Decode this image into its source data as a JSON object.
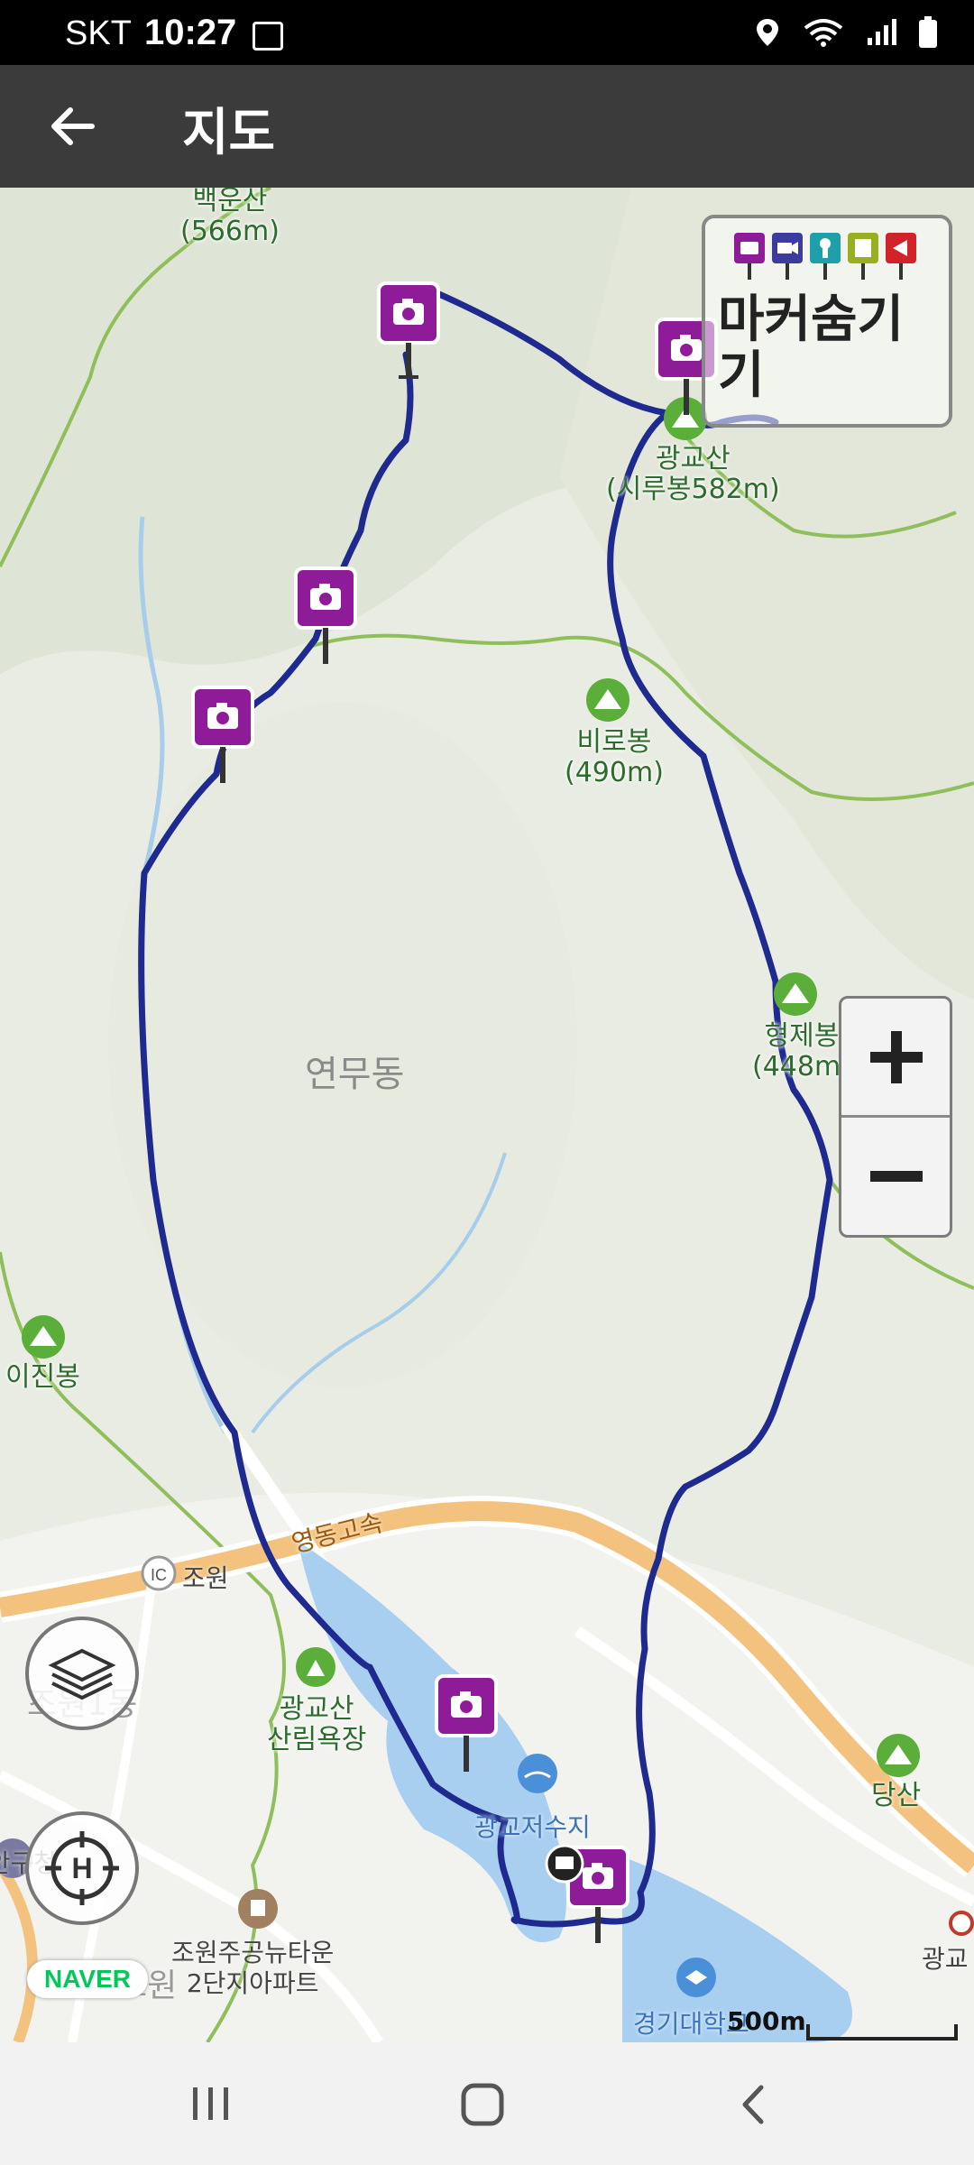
{
  "status_bar": {
    "carrier": "SKT",
    "time": "10:27"
  },
  "app_bar": {
    "title": "지도"
  },
  "legend": {
    "label": "마커숨기기",
    "marker_colors": [
      "#8e1b97",
      "#3c3c9e",
      "#1fa0a8",
      "#9aae22",
      "#d1232a"
    ]
  },
  "map": {
    "route_color": "#1e2a8f",
    "peaks": [
      {
        "name": "백운산",
        "elev": "(566m)"
      },
      {
        "name": "광교산",
        "elev": "(시루봉582m)"
      },
      {
        "name": "비로봉",
        "elev": "(490m)"
      },
      {
        "name": "형제봉",
        "elev": "(448m)"
      },
      {
        "name": "이진봉",
        "elev": ""
      },
      {
        "name": "당산",
        "elev": ""
      }
    ],
    "area_label": "연무동",
    "places": {
      "ic": "조원",
      "expressway": "영동고속",
      "forest": "광교산",
      "forest2": "산림욕장",
      "reservoir": "광교저수지",
      "apartment": "조원주공뉴타운",
      "apartment2": "2단지아파트",
      "university": "경기대학교",
      "gwanggyo": "광교",
      "left_dong": "조원1동",
      "left_gu": "장안구청",
      "left_won": "조원"
    },
    "scale_label": "500m",
    "brand": "NAVER"
  }
}
